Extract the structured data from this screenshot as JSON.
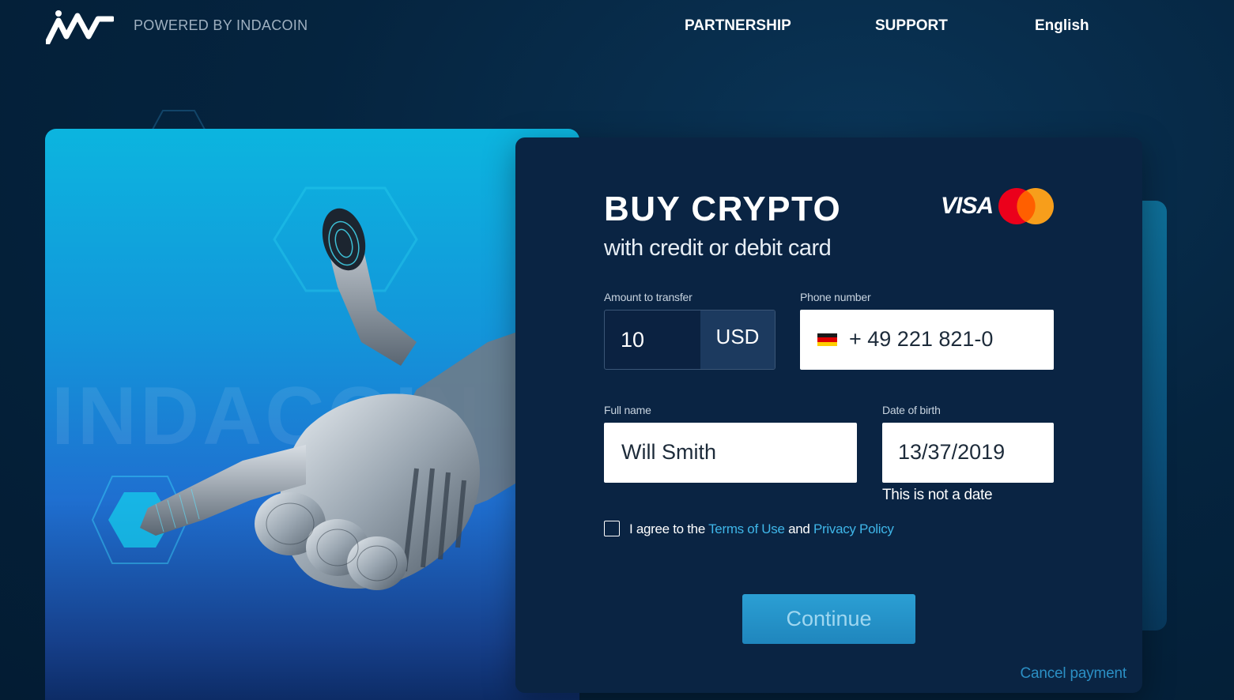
{
  "header": {
    "powered_by": "POWERED BY INDACOIN",
    "nav": {
      "partnership": "PARTNERSHIP",
      "support": "SUPPORT",
      "language": "English"
    }
  },
  "art": {
    "watermark": "INDACOIN"
  },
  "form": {
    "title": "BUY CRYPTO",
    "subtitle": "with credit or debit card",
    "card_brands": [
      "VISA",
      "Mastercard"
    ],
    "visa_text": "VISA",
    "amount": {
      "label": "Amount to transfer",
      "value": "10",
      "currency": "USD"
    },
    "phone": {
      "label": "Phone number",
      "value": "+ 49 221 821-0",
      "flag": "germany-flag"
    },
    "full_name": {
      "label": "Full name",
      "value": "Will Smith"
    },
    "dob": {
      "label": "Date of birth",
      "value": "13/37/2019",
      "error": "This is not a date"
    },
    "agreement": {
      "prefix": "I agree to the",
      "terms": "Terms of Use",
      "and": "and",
      "privacy": "Privacy Policy",
      "checked": false
    },
    "continue_label": "Continue",
    "cancel_label": "Cancel payment"
  },
  "colors": {
    "background": "#05243f",
    "card": "#0a2443",
    "accent": "#2b9fd4",
    "link": "#3fb6e8"
  }
}
